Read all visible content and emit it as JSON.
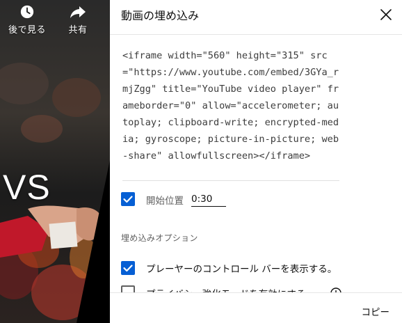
{
  "video": {
    "watch_later_label": "後で見る",
    "share_label": "共有",
    "overlay_text": "VS"
  },
  "dialog": {
    "title": "動画の埋め込み",
    "embed_code": "<iframe width=\"560\" height=\"315\" src=\"https://www.youtube.com/embed/3GYa_rmjZgg\" title=\"YouTube video player\" frameborder=\"0\" allow=\"accelerometer; autoplay; clipboard-write; encrypted-media; gyroscope; picture-in-picture; web-share\" allowfullscreen></iframe>",
    "start_at_label": "開始位置",
    "start_at_value": "0:30",
    "start_at_checked": true,
    "embed_options_heading": "埋め込みオプション",
    "options": [
      {
        "label": "プレーヤーのコントロール バーを表示する。",
        "checked": true
      },
      {
        "label": "プライバシー強化モードを有効にする。",
        "checked": false
      }
    ],
    "copy_label": "コピー"
  },
  "colors": {
    "accent": "#065fd4",
    "text": "#0f0f0f",
    "secondary_text": "#606060"
  }
}
